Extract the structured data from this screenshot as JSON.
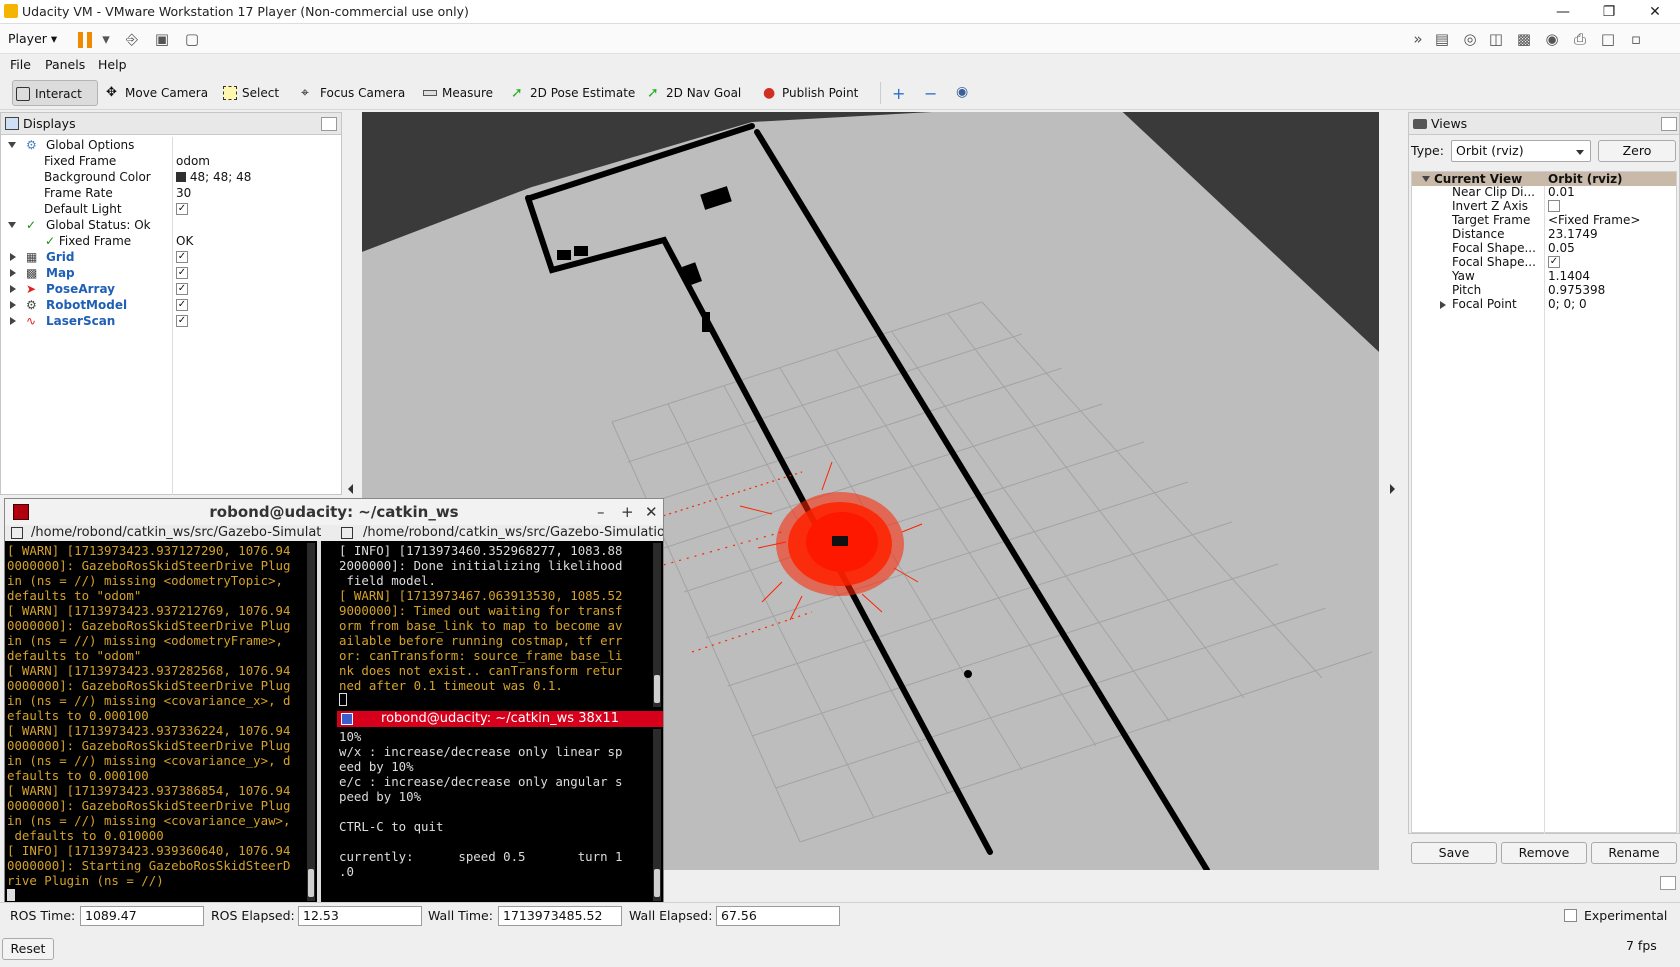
{
  "vm": {
    "title": "Udacity VM - VMware Workstation 17 Player (Non-commercial use only)",
    "player_menu": "Player"
  },
  "menu": {
    "file": "File",
    "panels": "Panels",
    "help": "Help"
  },
  "tools": [
    {
      "label": "Interact",
      "icon": "cursor-icon"
    },
    {
      "label": "Move Camera",
      "icon": "move-camera-icon"
    },
    {
      "label": "Select",
      "icon": "select-box-icon"
    },
    {
      "label": "Focus Camera",
      "icon": "focus-camera-icon"
    },
    {
      "label": "Measure",
      "icon": "ruler-icon"
    },
    {
      "label": "2D Pose Estimate",
      "icon": "pose-arrow-icon"
    },
    {
      "label": "2D Nav Goal",
      "icon": "nav-goal-arrow-icon"
    },
    {
      "label": "Publish Point",
      "icon": "map-pin-icon"
    }
  ],
  "displays": {
    "title": "Displays",
    "global_options": "Global Options",
    "fixed_frame_label": "Fixed Frame",
    "fixed_frame_value": "odom",
    "bg_color_label": "Background Color",
    "bg_color_value": "48; 48; 48",
    "frame_rate_label": "Frame Rate",
    "frame_rate_value": "30",
    "default_light_label": "Default Light",
    "global_status": "Global Status: Ok",
    "status_fixed_frame": "Fixed Frame",
    "status_value": "OK",
    "items": [
      {
        "label": "Grid",
        "icon": "grid-icon"
      },
      {
        "label": "Map",
        "icon": "map-icon"
      },
      {
        "label": "PoseArray",
        "icon": "pose-array-icon"
      },
      {
        "label": "RobotModel",
        "icon": "robot-model-icon"
      },
      {
        "label": "LaserScan",
        "icon": "laser-scan-icon"
      }
    ]
  },
  "views": {
    "title": "Views",
    "type_label": "Type:",
    "type_value": "Orbit (rviz)",
    "zero_label": "Zero",
    "current_view": "Current View",
    "current_view_value": "Orbit (rviz)",
    "props": [
      {
        "name": "Near Clip Di...",
        "value": "0.01"
      },
      {
        "name": "Invert Z Axis",
        "value": ""
      },
      {
        "name": "Target Frame",
        "value": "<Fixed Frame>"
      },
      {
        "name": "Distance",
        "value": "23.1749"
      },
      {
        "name": "Focal Shape...",
        "value": "0.05"
      },
      {
        "name": "Focal Shape...",
        "value": ""
      },
      {
        "name": "Yaw",
        "value": "1.1404"
      },
      {
        "name": "Pitch",
        "value": "0.975398"
      },
      {
        "name": "Focal Point",
        "value": "0; 0; 0"
      }
    ],
    "save": "Save",
    "remove": "Remove",
    "rename": "Rename"
  },
  "terminal": {
    "title": "robond@udacity: ~/catkin_ws",
    "tab1": "/home/robond/catkin_ws/src/Gazebo-Simulatic",
    "tab2": "/home/robond/catkin_ws/src/Gazebo-Simulatio",
    "left_log": "[ WARN] [1713973423.937127290, 1076.94\n0000000]: GazeboRosSkidSteerDrive Plug\nin (ns = //) missing <odometryTopic>,\ndefaults to \"odom\"\n[ WARN] [1713973423.937212769, 1076.94\n0000000]: GazeboRosSkidSteerDrive Plug\nin (ns = //) missing <odometryFrame>,\ndefaults to \"odom\"\n[ WARN] [1713973423.937282568, 1076.94\n0000000]: GazeboRosSkidSteerDrive Plug\nin (ns = //) missing <covariance_x>, d\nefaults to 0.000100\n[ WARN] [1713973423.937336224, 1076.94\n0000000]: GazeboRosSkidSteerDrive Plug\nin (ns = //) missing <covariance_y>, d\nefaults to 0.000100\n[ WARN] [1713973423.937386854, 1076.94\n0000000]: GazeboRosSkidSteerDrive Plug\nin (ns = //) missing <covariance_yaw>,\n defaults to 0.010000\n[ INFO] [1713973423.939360640, 1076.94\n0000000]: Starting GazeboRosSkidSteerD\nrive Plugin (ns = //)",
    "right_info": "[ INFO] [1713973460.352968277, 1083.88\n2000000]: Done initializing likelihood\n field model.",
    "right_warn": "[ WARN] [1713973467.063913530, 1085.52\n9000000]: Timed out waiting for transf\norm from base_link to map to become av\nailable before running costmap, tf err\nor: canTransform: source_frame base_li\nnk does not exist.. canTransform retur\nned after 0.1 timeout was 0.1.",
    "teleop_title": "robond@udacity: ~/catkin_ws 38x11",
    "teleop_log": "10%\nw/x : increase/decrease only linear sp\need by 10%\ne/c : increase/decrease only angular s\npeed by 10%\n\nCTRL-C to quit\n\ncurrently:      speed 0.5       turn 1\n.0"
  },
  "time": {
    "ros_time_label": "ROS Time:",
    "ros_time": "1089.47",
    "ros_elapsed_label": "ROS Elapsed:",
    "ros_elapsed": "12.53",
    "wall_time_label": "Wall Time:",
    "wall_time": "1713973485.52",
    "wall_elapsed_label": "Wall Elapsed:",
    "wall_elapsed": "67.56",
    "experimental": "Experimental"
  },
  "reset": "Reset",
  "fps": "7 fps",
  "colors": {
    "particle": "#ff2200",
    "wall": "#000000",
    "accent_title": "#d6001c"
  }
}
